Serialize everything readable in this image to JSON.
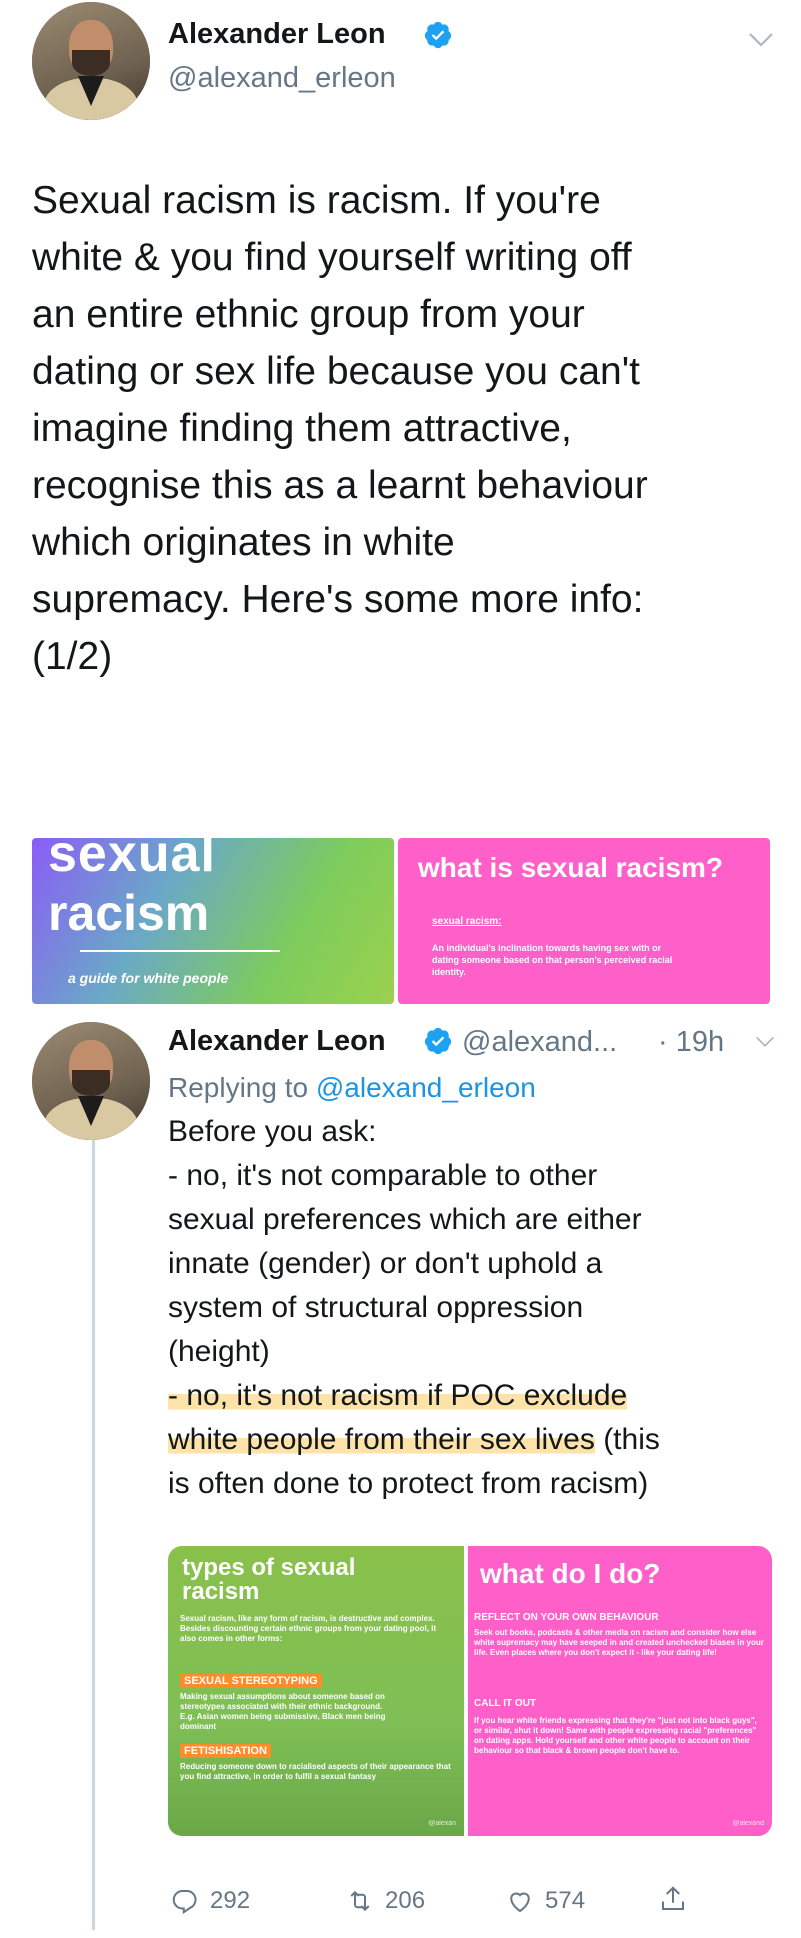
{
  "tweet": {
    "author_name": "Alexander Leon",
    "author_handle": "@alexand_erleon",
    "text": "Sexual racism is racism. If you're\nwhite & you find yourself writing off\nan entire ethnic group from your\ndating or sex life because you can't\nimagine finding them attractive,\nrecognise this as a learnt behaviour\nwhich originates in white\nsupremacy. Here's some more info:\n(1/2)",
    "images": [
      {
        "title_line1": "sexual",
        "title_line2": "racism",
        "subtitle": "a guide for white people"
      },
      {
        "title": "what is sexual racism?",
        "label": "sexual racism:",
        "body": "An individual's inclination towards having sex with or dating someone based on that person's perceived racial identity."
      }
    ]
  },
  "reply": {
    "author_name": "Alexander Leon",
    "author_handle": "@alexand...",
    "time": "· 19h",
    "replying_prefix": "Replying to",
    "replying_handle": "@alexand_erleon",
    "text_part1": "Before you ask:\n- no, it's not comparable to other\nsexual preferences which are either\ninnate (gender) or don't uphold a\nsystem of structural oppression\n(height)\n",
    "text_highlight": "- no, it's not racism if POC exclude\nwhite people from their sex lives",
    "text_part2": " (this\nis often done to protect from racism)",
    "images": [
      {
        "title": "types of sexual racism",
        "intro": "Sexual racism, like any form of racism, is destructive and complex. Besides discounting certain ethnic groups from your dating pool, it also comes in other forms:",
        "section1_title": "SEXUAL STEREOTYPING",
        "section1_text": "Making sexual assumptions about someone based on stereotypes associated with their ethnic background. E.g. Asian women being submissive, Black men being dominant",
        "section2_title": "FETISHISATION",
        "section2_text": "Reducing someone down to racialised aspects of their appearance that you find attractive, in order to fulfil a sexual fantasy",
        "watermark": "@alexan"
      },
      {
        "title": "what do I do?",
        "section1_title": "REFLECT ON YOUR OWN BEHAVIOUR",
        "section1_text": "Seek out books, podcasts & other media on racism and consider how else white supremacy may have seeped in and created unchecked biases in your life. Even places where you don't expect it - like your dating life!",
        "section2_title": "CALL IT OUT",
        "section2_text": "If you hear white friends expressing that they're \"just not into black guys\", or similar, shut it down! Same with people expressing racial \"preferences\" on dating apps. Hold yourself and other white people to account on their behaviour so that black & brown people don't have to.",
        "watermark": "@alexand"
      }
    ],
    "actions": {
      "replies": "292",
      "retweets": "206",
      "likes": "574"
    }
  },
  "colors": {
    "link": "#1b95e0",
    "verified": "#1da1f2",
    "highlight": "#fde3a7",
    "card_green": "#7fbf55",
    "card_pink": "#ff5fc8"
  },
  "icons": [
    "verified-badge-icon",
    "chevron-down-icon",
    "reply-icon",
    "retweet-icon",
    "like-icon",
    "share-icon"
  ]
}
